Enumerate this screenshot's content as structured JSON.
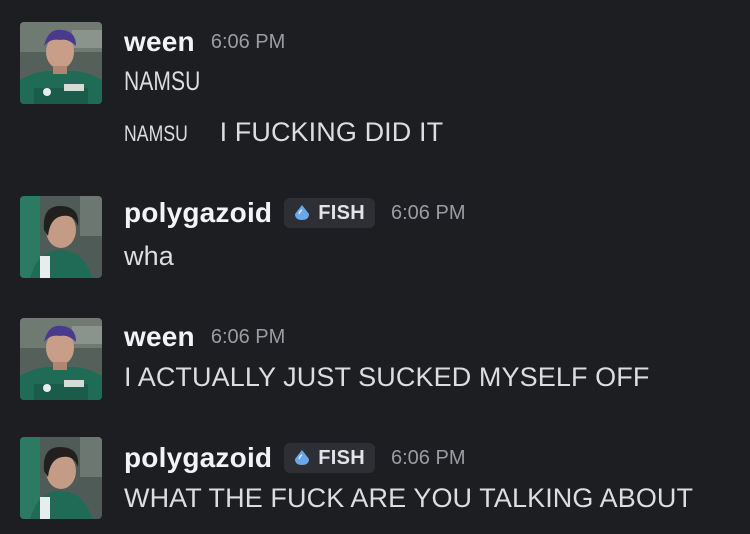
{
  "colors": {
    "background": "#1d1e22",
    "username": "#f2f3f5",
    "timestamp": "#9a9ca3",
    "message_text": "#dcdde1",
    "role_tag_bg": "#2d2f35",
    "role_icon": "#6aa7e8"
  },
  "messages": [
    {
      "username": "ween",
      "timestamp": "6:06 PM",
      "role": null,
      "lines": [
        "NAMSU"
      ],
      "extra_line": {
        "prefix": "NAMSU",
        "text": "I FUCKING DID IT"
      }
    },
    {
      "username": "polygazoid",
      "timestamp": "6:06 PM",
      "role": {
        "label": "FISH",
        "icon": "water-drop-icon"
      },
      "lines": [
        "wha"
      ]
    },
    {
      "username": "ween",
      "timestamp": "6:06 PM",
      "role": null,
      "lines": [
        "I ACTUALLY JUST SUCKED MYSELF OFF"
      ]
    },
    {
      "username": "polygazoid",
      "timestamp": "6:06 PM",
      "role": {
        "label": "FISH",
        "icon": "water-drop-icon"
      },
      "lines": [
        "WHAT THE FUCK ARE YOU TALKING ABOUT"
      ]
    }
  ]
}
